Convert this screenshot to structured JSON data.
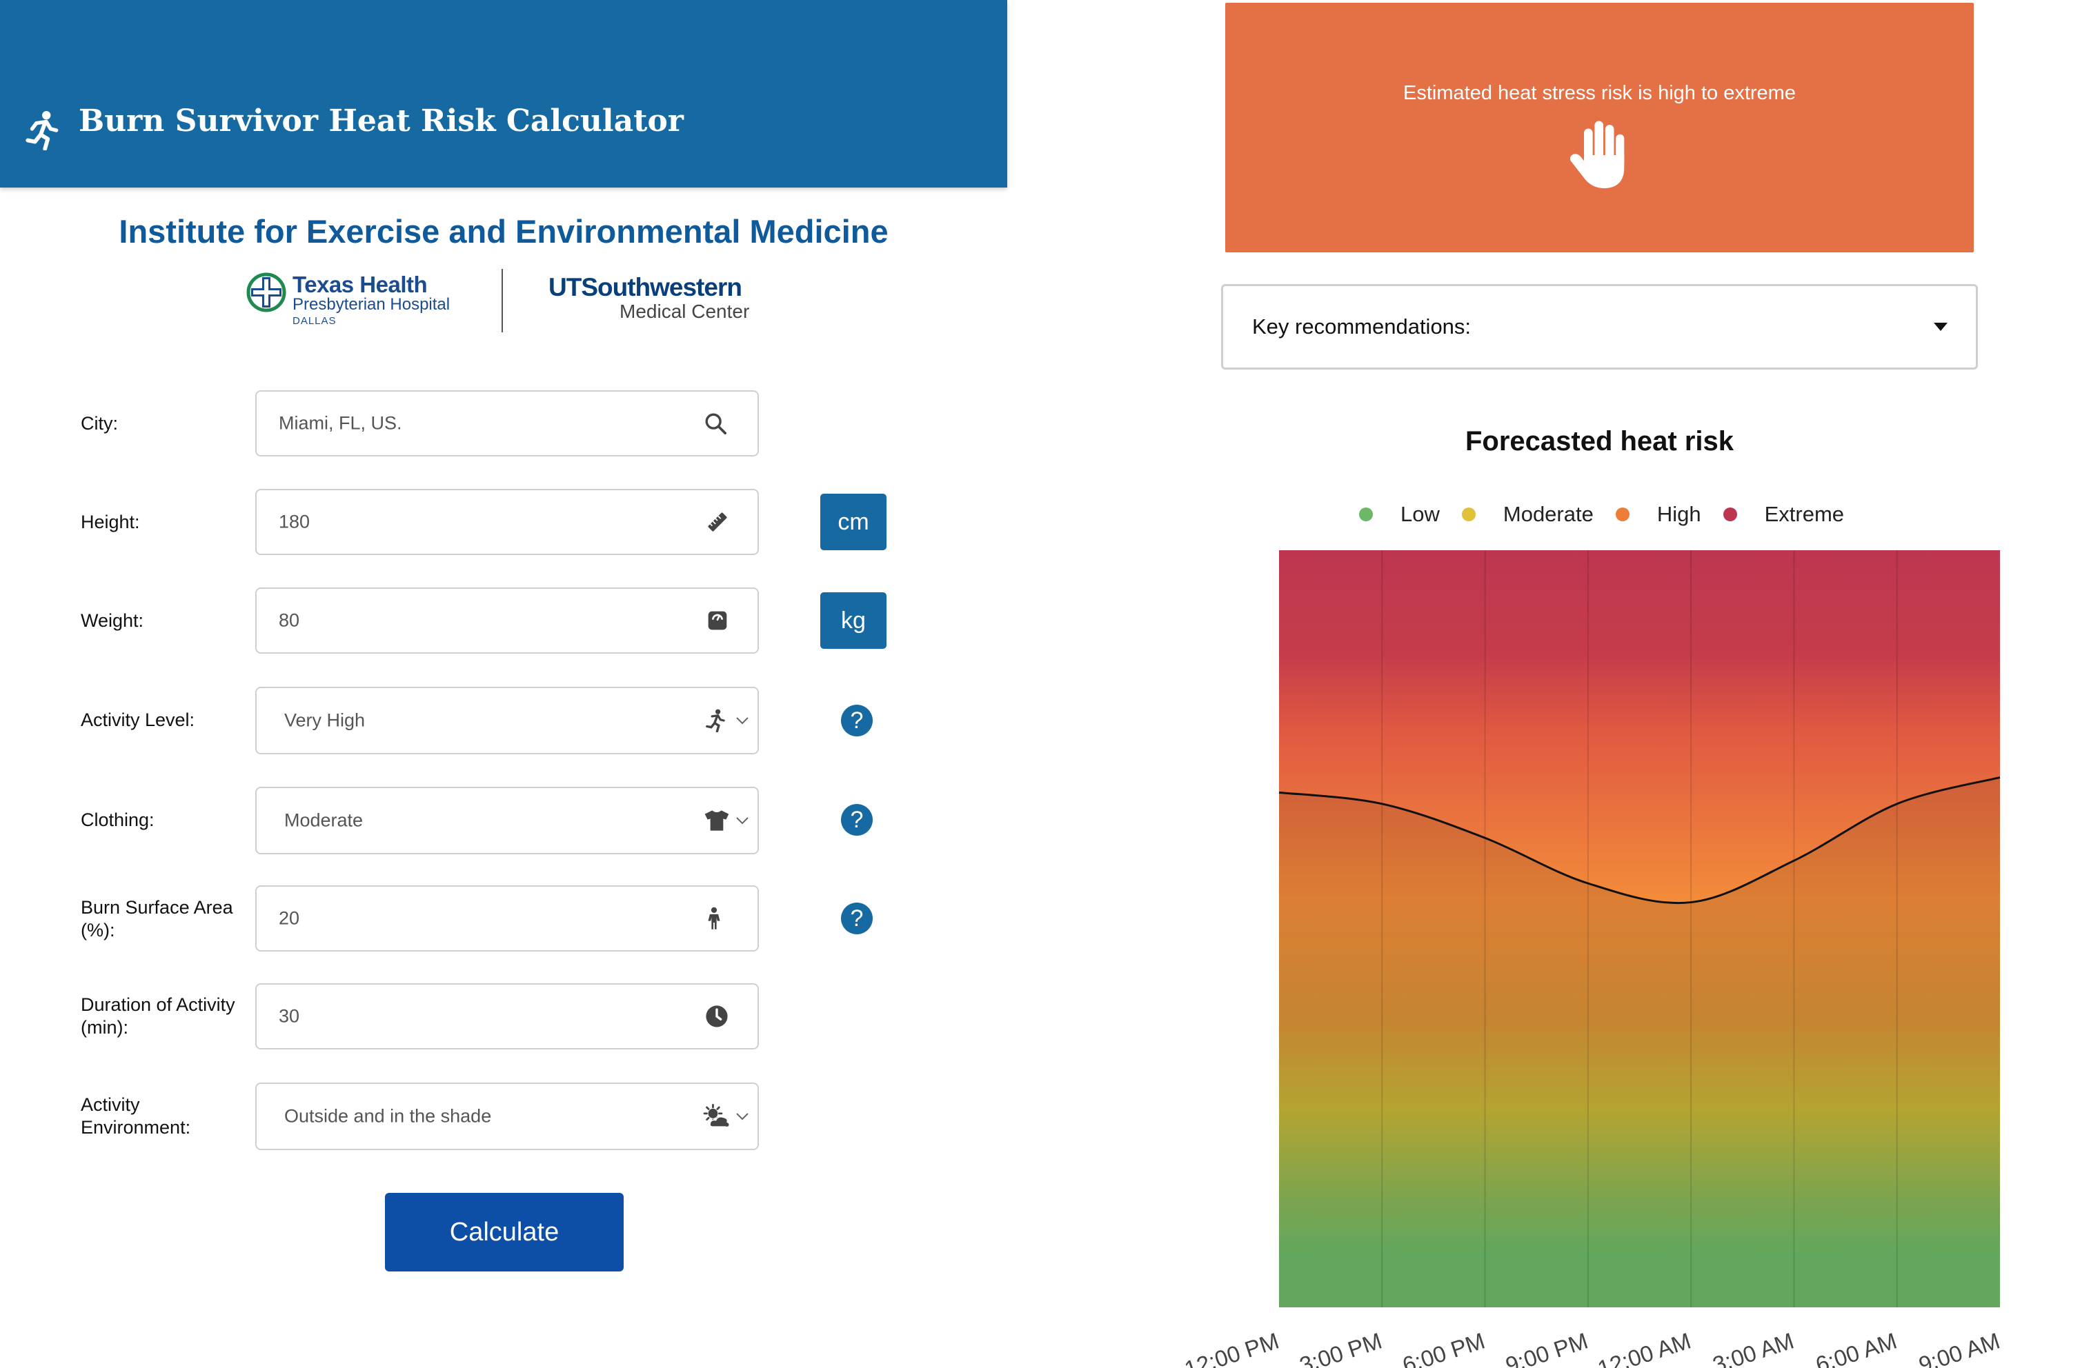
{
  "header": {
    "title": "Burn Survivor Heat Risk Calculator",
    "icon": "running-person-icon"
  },
  "institute": {
    "title": "Institute for Exercise and Environmental Medicine"
  },
  "logos": {
    "texas_health": {
      "name": "Texas Health",
      "sub": "Presbyterian Hospital",
      "city": "DALLAS"
    },
    "ut_southwestern": {
      "name": "UTSouthwestern",
      "sub": "Medical Center"
    }
  },
  "form": {
    "city": {
      "label": "City:",
      "value": "Miami, FL, US.",
      "icon": "search-icon"
    },
    "height": {
      "label": "Height:",
      "value": "180",
      "icon": "ruler-icon",
      "unit": "cm"
    },
    "weight": {
      "label": "Weight:",
      "value": "80",
      "icon": "scale-icon",
      "unit": "kg"
    },
    "activity_level": {
      "label": "Activity Level:",
      "value": "Very High",
      "icon": "running-person-icon",
      "help": "?"
    },
    "clothing": {
      "label": "Clothing:",
      "value": "Moderate",
      "icon": "tshirt-icon",
      "help": "?"
    },
    "burn_surface": {
      "label": "Burn Surface Area (%):",
      "value": "20",
      "icon": "person-icon",
      "help": "?"
    },
    "duration": {
      "label": "Duration of Activity (min):",
      "value": "30",
      "icon": "clock-icon"
    },
    "environment": {
      "label": "Activity Environment:",
      "value": "Outside and in the shade",
      "icon": "sun-cloud-icon"
    },
    "calculate_label": "Calculate"
  },
  "result": {
    "banner_text": "Estimated heat stress risk is high to extreme",
    "banner_color": "#e47046",
    "banner_icon": "raised-hand-icon",
    "key_recommendations_label": "Key recommendations:"
  },
  "colors": {
    "accent": "#176aa1",
    "calculate": "#0d4ea6"
  },
  "chart_data": {
    "type": "area",
    "title": "Forecasted heat risk",
    "legend": [
      {
        "name": "Low",
        "color": "#6cb867"
      },
      {
        "name": "Moderate",
        "color": "#e0c23a"
      },
      {
        "name": "High",
        "color": "#ee7d3a"
      },
      {
        "name": "Extreme",
        "color": "#bd3650"
      }
    ],
    "legend_position": "top-center",
    "x": [
      "12:00 PM",
      "3:00 PM",
      "6:00 PM",
      "9:00 PM",
      "12:00 AM",
      "3:00 AM",
      "6:00 AM",
      "9:00 AM"
    ],
    "y": [
      0.68,
      0.665,
      0.62,
      0.56,
      0.535,
      0.59,
      0.665,
      0.7
    ],
    "ylim": [
      0,
      1
    ],
    "y_axis_shown": false,
    "grid": "vertical"
  }
}
